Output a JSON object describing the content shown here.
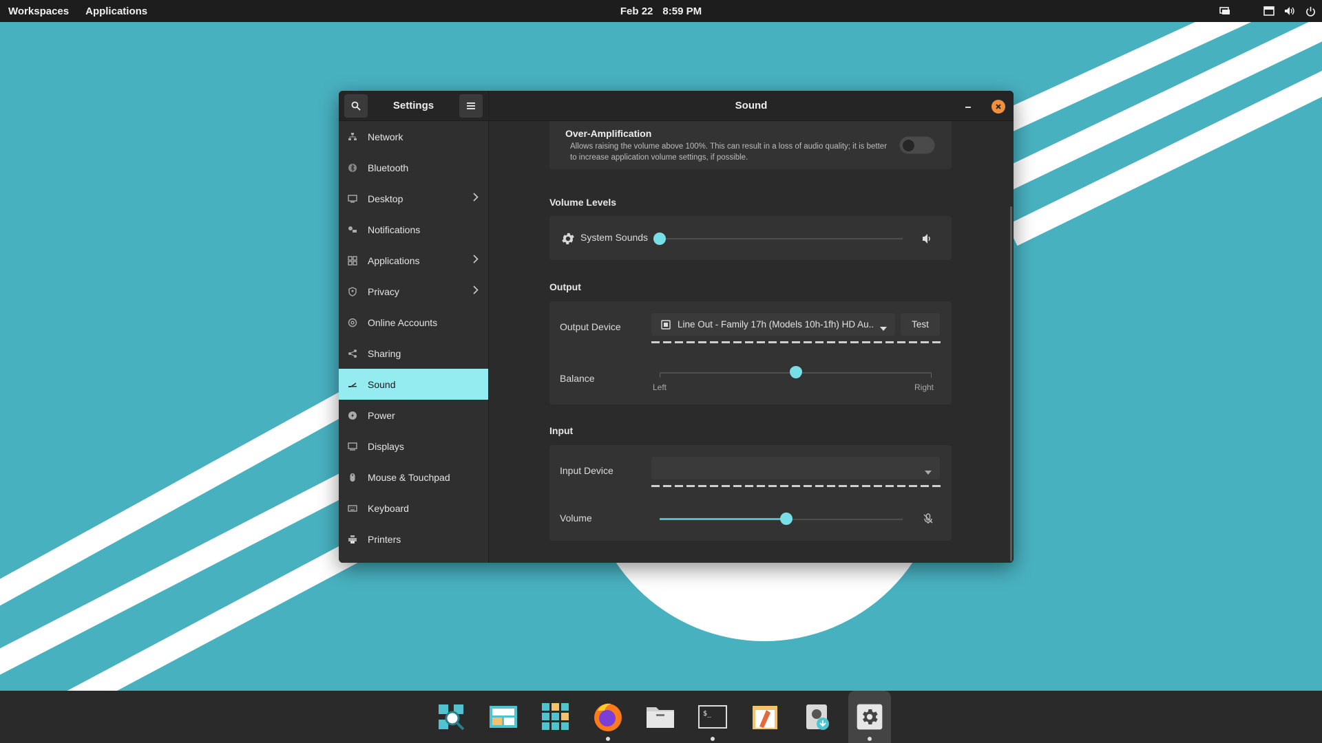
{
  "topbar": {
    "workspaces": "Workspaces",
    "applications": "Applications",
    "date": "Feb 22",
    "time": "8:59 PM"
  },
  "sidebar": {
    "title": "Settings",
    "items": [
      {
        "label": "Network",
        "icon": "network-icon"
      },
      {
        "label": "Bluetooth",
        "icon": "bluetooth-icon"
      },
      {
        "label": "Desktop",
        "icon": "desktop-icon",
        "chevron": true
      },
      {
        "label": "Notifications",
        "icon": "notifications-icon"
      },
      {
        "label": "Applications",
        "icon": "applications-grid-icon",
        "chevron": true
      },
      {
        "label": "Privacy",
        "icon": "privacy-icon",
        "chevron": true
      },
      {
        "label": "Online Accounts",
        "icon": "at-sign-icon"
      },
      {
        "label": "Sharing",
        "icon": "share-icon"
      },
      {
        "label": "Sound",
        "icon": "sound-icon",
        "active": true
      },
      {
        "label": "Power",
        "icon": "power-icon"
      },
      {
        "label": "Displays",
        "icon": "display-icon"
      },
      {
        "label": "Mouse & Touchpad",
        "icon": "mouse-icon"
      },
      {
        "label": "Keyboard",
        "icon": "keyboard-icon"
      },
      {
        "label": "Printers",
        "icon": "printer-icon"
      }
    ]
  },
  "main": {
    "title": "Sound",
    "over_amplification": {
      "title": "Over-Amplification",
      "description": "Allows raising the volume above 100%. This can result in a loss of audio quality; it is better to increase application volume settings, if possible.",
      "enabled": false
    },
    "volume_levels": {
      "title": "Volume Levels",
      "system_sounds_label": "System Sounds",
      "system_sounds_level": 0
    },
    "output": {
      "title": "Output",
      "device_label": "Output Device",
      "device_value": "Line Out - Family 17h (Models 10h-1fh) HD Au...",
      "test_label": "Test",
      "balance_label": "Balance",
      "balance_value": 0.5,
      "left_label": "Left",
      "right_label": "Right"
    },
    "input": {
      "title": "Input",
      "device_label": "Input Device",
      "device_value": "",
      "volume_label": "Volume",
      "volume_level": 0.52
    }
  },
  "dock": {
    "items": [
      {
        "icon": "search-app-icon",
        "running": false
      },
      {
        "icon": "workspaces-app-icon",
        "running": false
      },
      {
        "icon": "app-grid-icon",
        "running": false
      },
      {
        "icon": "firefox-icon",
        "running": true
      },
      {
        "icon": "files-icon",
        "running": false
      },
      {
        "icon": "terminal-icon",
        "running": true
      },
      {
        "icon": "text-editor-icon",
        "running": false
      },
      {
        "icon": "popshop-icon",
        "running": false
      },
      {
        "icon": "settings-app-icon",
        "running": true,
        "active": true
      }
    ]
  },
  "colors": {
    "wallpaper": "#48b1c0",
    "accent": "#94ebf0",
    "slider": "#79dfe6",
    "close": "#f0903a"
  }
}
